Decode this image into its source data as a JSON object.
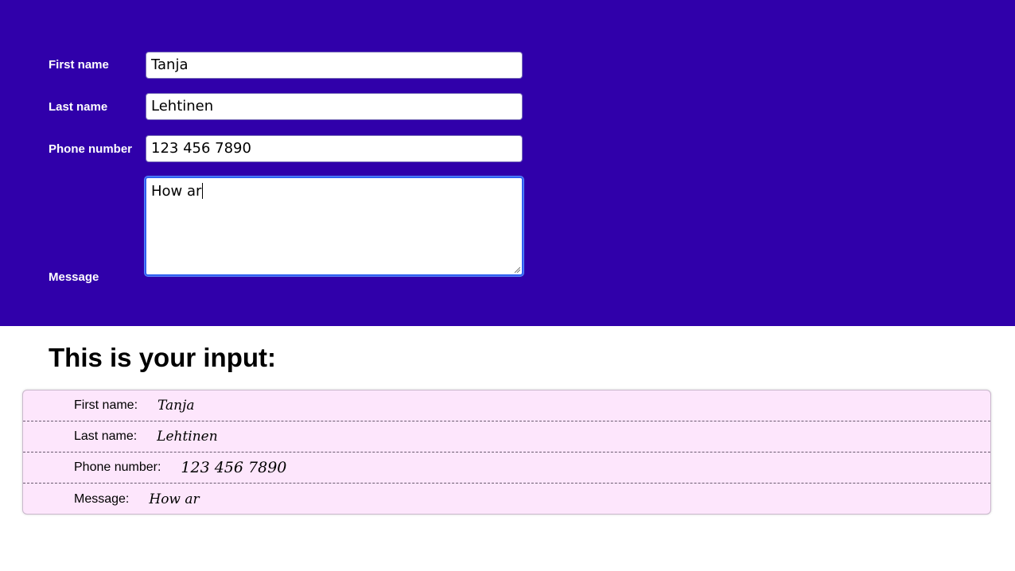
{
  "form": {
    "first_name_label": "First name",
    "first_name_value": "Tanja",
    "last_name_label": "Last name",
    "last_name_value": "Lehtinen",
    "phone_label": "Phone number",
    "phone_value": "123 456 7890",
    "message_label": "Message",
    "message_value": "How ar"
  },
  "output": {
    "heading": "This is your input:",
    "rows": [
      {
        "label": "First name:",
        "value": "Tanja"
      },
      {
        "label": "Last name:",
        "value": "Lehtinen"
      },
      {
        "label": "Phone number:",
        "value": "123 456 7890"
      },
      {
        "label": "Message:",
        "value": "How ar"
      }
    ]
  },
  "colors": {
    "form_background": "#3000aa",
    "output_background": "#fde6fc",
    "focus_border": "#2f5ff0"
  }
}
